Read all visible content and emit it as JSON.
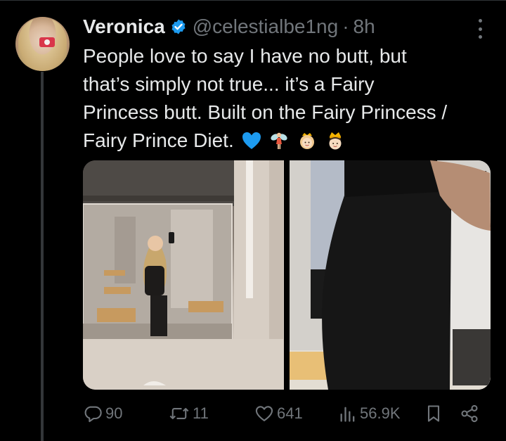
{
  "tweet": {
    "author_name": "Veronica",
    "handle": "@celestialbe1ng",
    "separator": "·",
    "time": "8h",
    "text_lines": [
      "People love to say I have no butt, but",
      "that’s simply not true... it’s a Fairy",
      "Princess butt. Built on the Fairy Princess /",
      "Fairy Prince Diet."
    ],
    "emojis": [
      "blue-heart-icon",
      "fairy-icon",
      "princess-icon",
      "prince-icon"
    ],
    "media_count": 2
  },
  "actions": {
    "replies": "90",
    "reposts": "11",
    "likes": "641",
    "views": "56.9K"
  },
  "colors": {
    "background": "#000000",
    "text_primary": "#e7e9ea",
    "text_secondary": "#71767b",
    "verified": "#1d9bf0",
    "thread_line": "#333639"
  }
}
